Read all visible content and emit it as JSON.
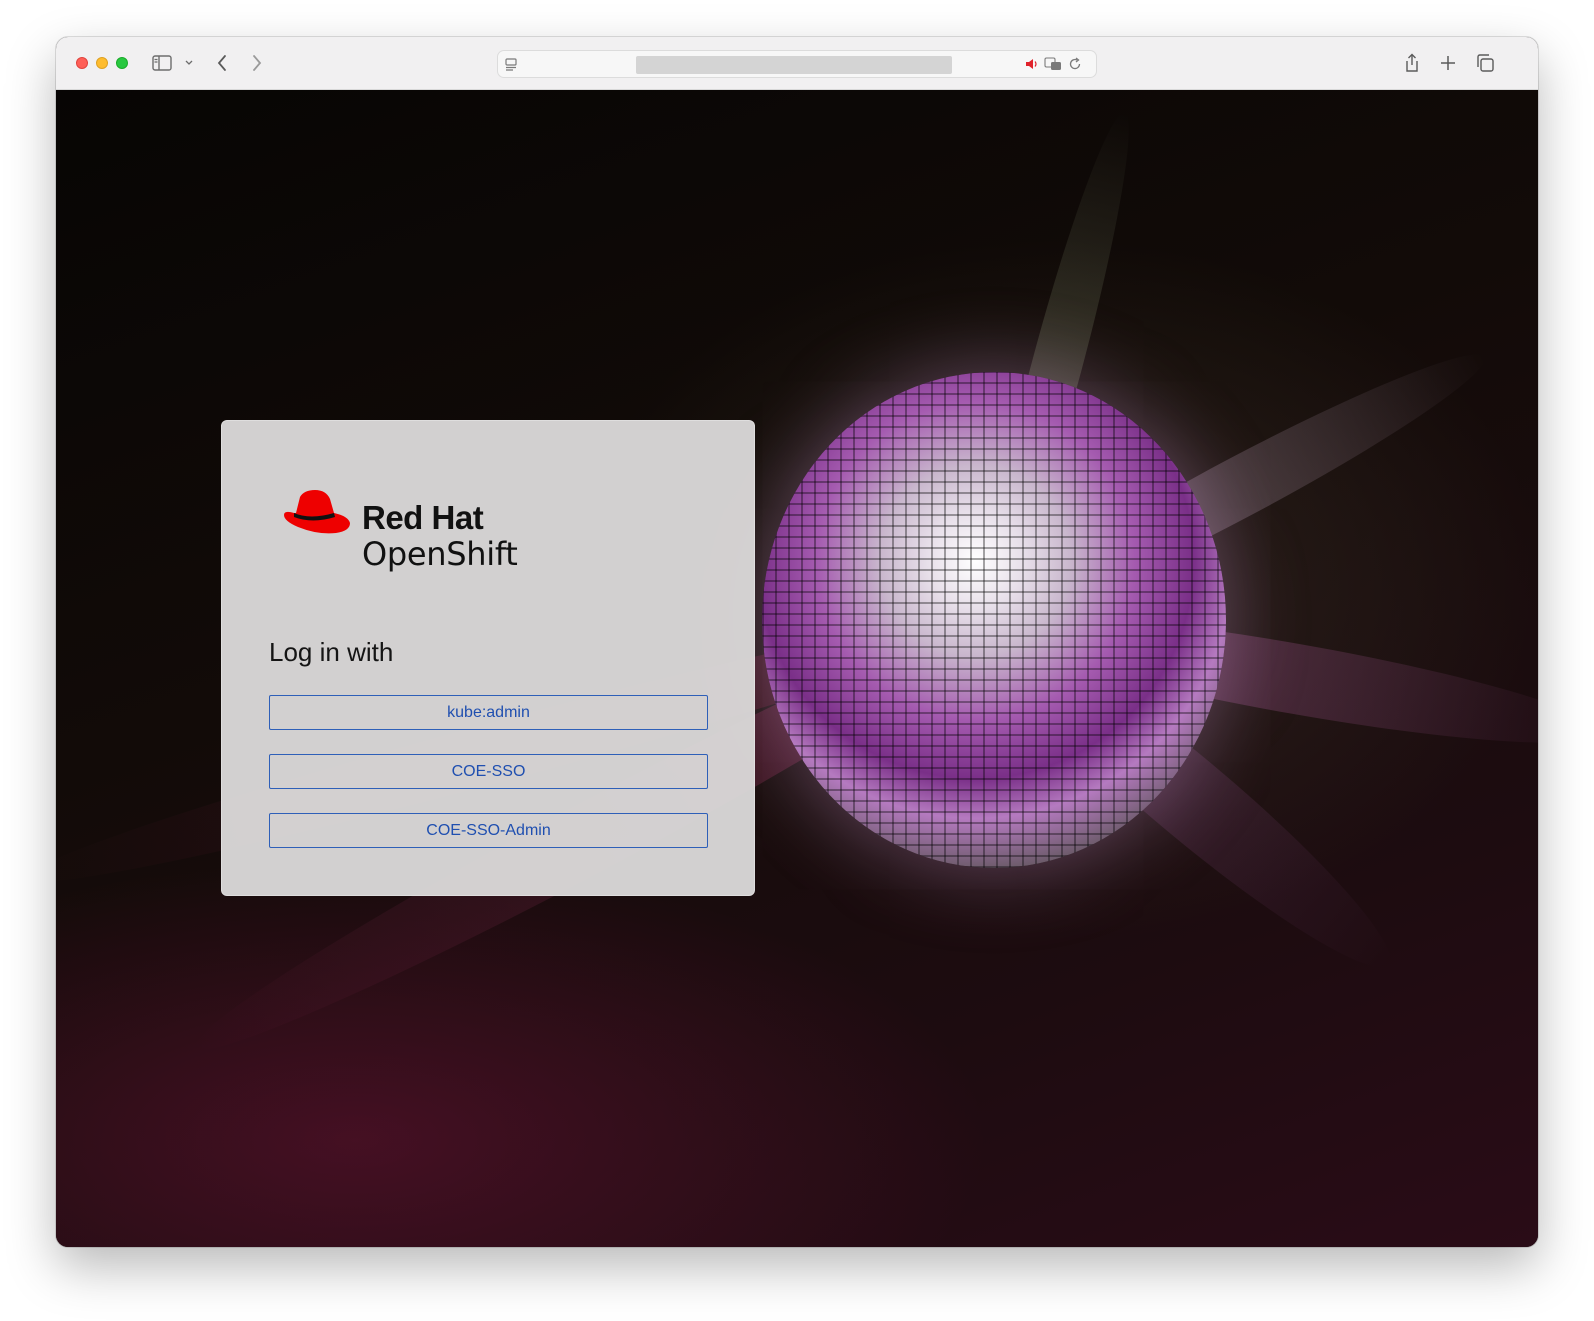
{
  "browser": {
    "url": "",
    "sidebar_icon": "sidebar-icon",
    "back_icon": "chevron-left-icon",
    "forward_icon": "chevron-right-icon",
    "share_icon": "share-icon",
    "new_tab_icon": "plus-icon",
    "tabs_overview_icon": "tabs-icon"
  },
  "brand": {
    "line1": "Red Hat",
    "line2": "OpenShift",
    "hat_color": "#ee0000"
  },
  "login": {
    "title": "Log in with",
    "providers": [
      {
        "label": "kube:admin"
      },
      {
        "label": "COE-SSO"
      },
      {
        "label": "COE-SSO-Admin"
      }
    ]
  },
  "colors": {
    "link_blue": "#1f4fb0",
    "card_bg": "#d9d7d7"
  }
}
